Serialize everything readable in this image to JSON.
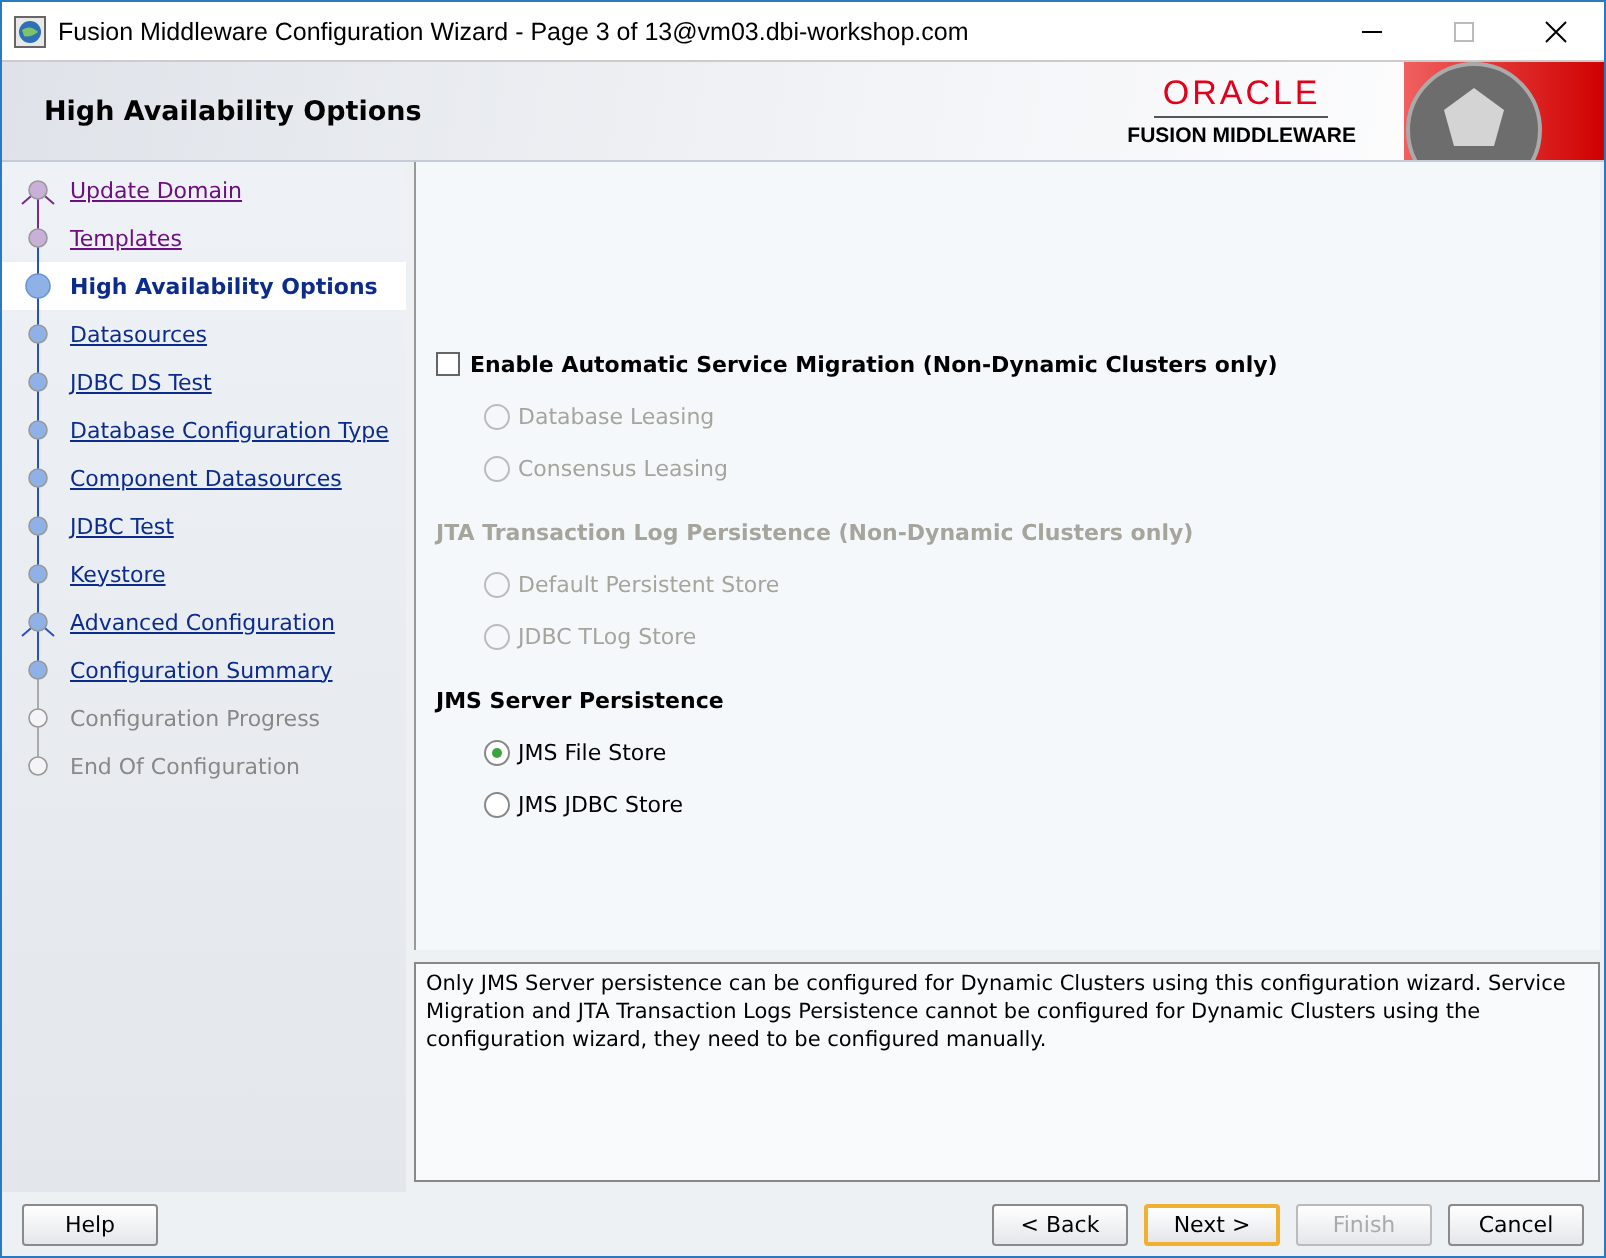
{
  "window": {
    "title": "Fusion Middleware Configuration Wizard - Page 3 of 13@vm03.dbi-workshop.com"
  },
  "header": {
    "title": "High Availability Options",
    "logo_brand": "ORACLE",
    "logo_product": "FUSION MIDDLEWARE"
  },
  "steps": [
    {
      "label": "Update Domain",
      "kind": "visited",
      "branch": true,
      "selected": false
    },
    {
      "label": "Templates",
      "kind": "visited",
      "branch": false,
      "selected": false
    },
    {
      "label": "High Availability Options",
      "kind": "current",
      "branch": false,
      "selected": true
    },
    {
      "label": "Datasources",
      "kind": "pending",
      "branch": false,
      "selected": false
    },
    {
      "label": "JDBC DS Test",
      "kind": "pending",
      "branch": false,
      "selected": false
    },
    {
      "label": "Database Configuration Type",
      "kind": "pending",
      "branch": false,
      "selected": false
    },
    {
      "label": "Component Datasources",
      "kind": "pending",
      "branch": false,
      "selected": false
    },
    {
      "label": "JDBC Test",
      "kind": "pending",
      "branch": false,
      "selected": false
    },
    {
      "label": "Keystore",
      "kind": "pending",
      "branch": false,
      "selected": false
    },
    {
      "label": "Advanced Configuration",
      "kind": "pending",
      "branch": true,
      "selected": false
    },
    {
      "label": "Configuration Summary",
      "kind": "pending",
      "branch": false,
      "selected": false
    },
    {
      "label": "Configuration Progress",
      "kind": "disabled",
      "branch": false,
      "selected": false
    },
    {
      "label": "End Of Configuration",
      "kind": "disabled",
      "branch": false,
      "selected": false
    }
  ],
  "options": [
    {
      "kind": "checkbox",
      "label": "Enable Automatic Service Migration (Non-Dynamic Clusters only)",
      "checked": false
    },
    {
      "kind": "radio",
      "label": "Database Leasing",
      "selected": false,
      "disabled": true
    },
    {
      "kind": "radio",
      "label": "Consensus Leasing",
      "selected": false,
      "disabled": true
    },
    {
      "kind": "heading",
      "label": "JTA Transaction Log Persistence (Non-Dynamic Clusters only)",
      "disabled": true
    },
    {
      "kind": "radio",
      "label": "Default Persistent Store",
      "selected": false,
      "disabled": true
    },
    {
      "kind": "radio",
      "label": "JDBC TLog Store",
      "selected": false,
      "disabled": true
    },
    {
      "kind": "heading",
      "label": "JMS Server Persistence",
      "disabled": false
    },
    {
      "kind": "radio",
      "label": "JMS File Store",
      "selected": true,
      "disabled": false
    },
    {
      "kind": "radio",
      "label": "JMS JDBC Store",
      "selected": false,
      "disabled": false
    }
  ],
  "message": "Only JMS Server persistence can be configured for Dynamic Clusters using this configuration wizard. Service Migration and JTA Transaction Logs Persistence cannot be configured for Dynamic Clusters using the configuration wizard, they need to be configured manually.",
  "help_button": {
    "label": "Help"
  },
  "buttons": [
    {
      "label": "< Back",
      "disabled": false,
      "focused": false
    },
    {
      "label": "Next >",
      "disabled": false,
      "focused": true
    },
    {
      "label": "Finish",
      "disabled": true,
      "focused": false
    },
    {
      "label": "Cancel",
      "disabled": false,
      "focused": false
    }
  ]
}
